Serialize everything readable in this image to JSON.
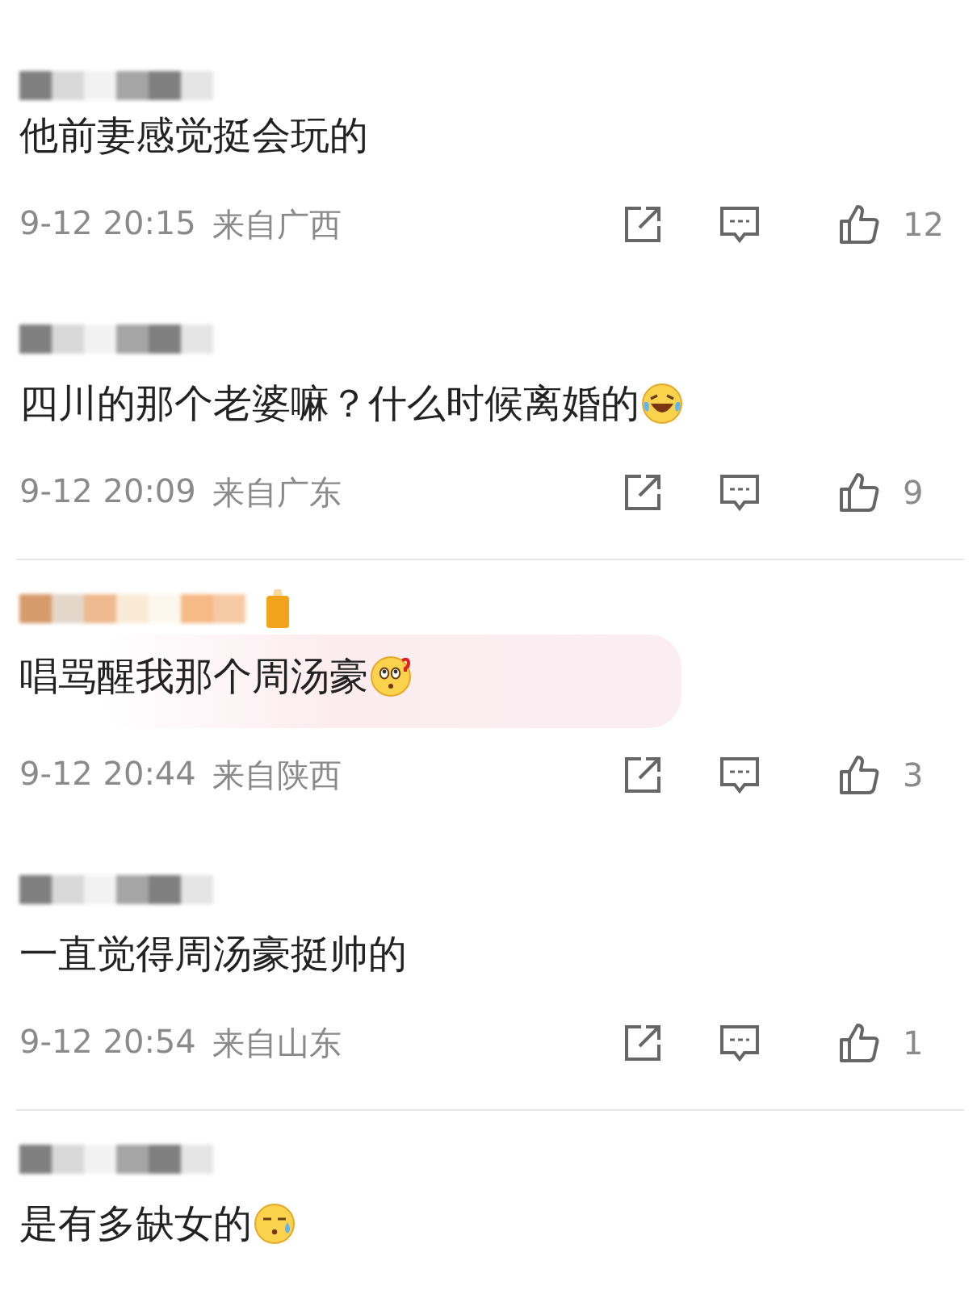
{
  "comments": [
    {
      "text": "他前妻感觉挺会玩的",
      "time": "9-12 20:15",
      "location": "来自广西",
      "likes": "12"
    },
    {
      "text": "四川的那个老婆嘛？什么时候离婚的",
      "emoji": {
        "kind": "laughing"
      },
      "time": "9-12 20:09",
      "location": "来自广东",
      "likes": "9",
      "divider": true
    },
    {
      "text": "唱骂醒我那个周汤豪",
      "emoji": {
        "kind": "puzzled"
      },
      "highlighted": true,
      "badge": true,
      "time": "9-12 20:44",
      "location": "来自陕西",
      "likes": "3"
    },
    {
      "text": "一直觉得周汤豪挺帅的",
      "time": "9-12 20:54",
      "location": "来自山东",
      "likes": "1",
      "divider": true
    },
    {
      "text": "是有多缺女的",
      "emoji": {
        "kind": "sweat"
      }
    }
  ]
}
